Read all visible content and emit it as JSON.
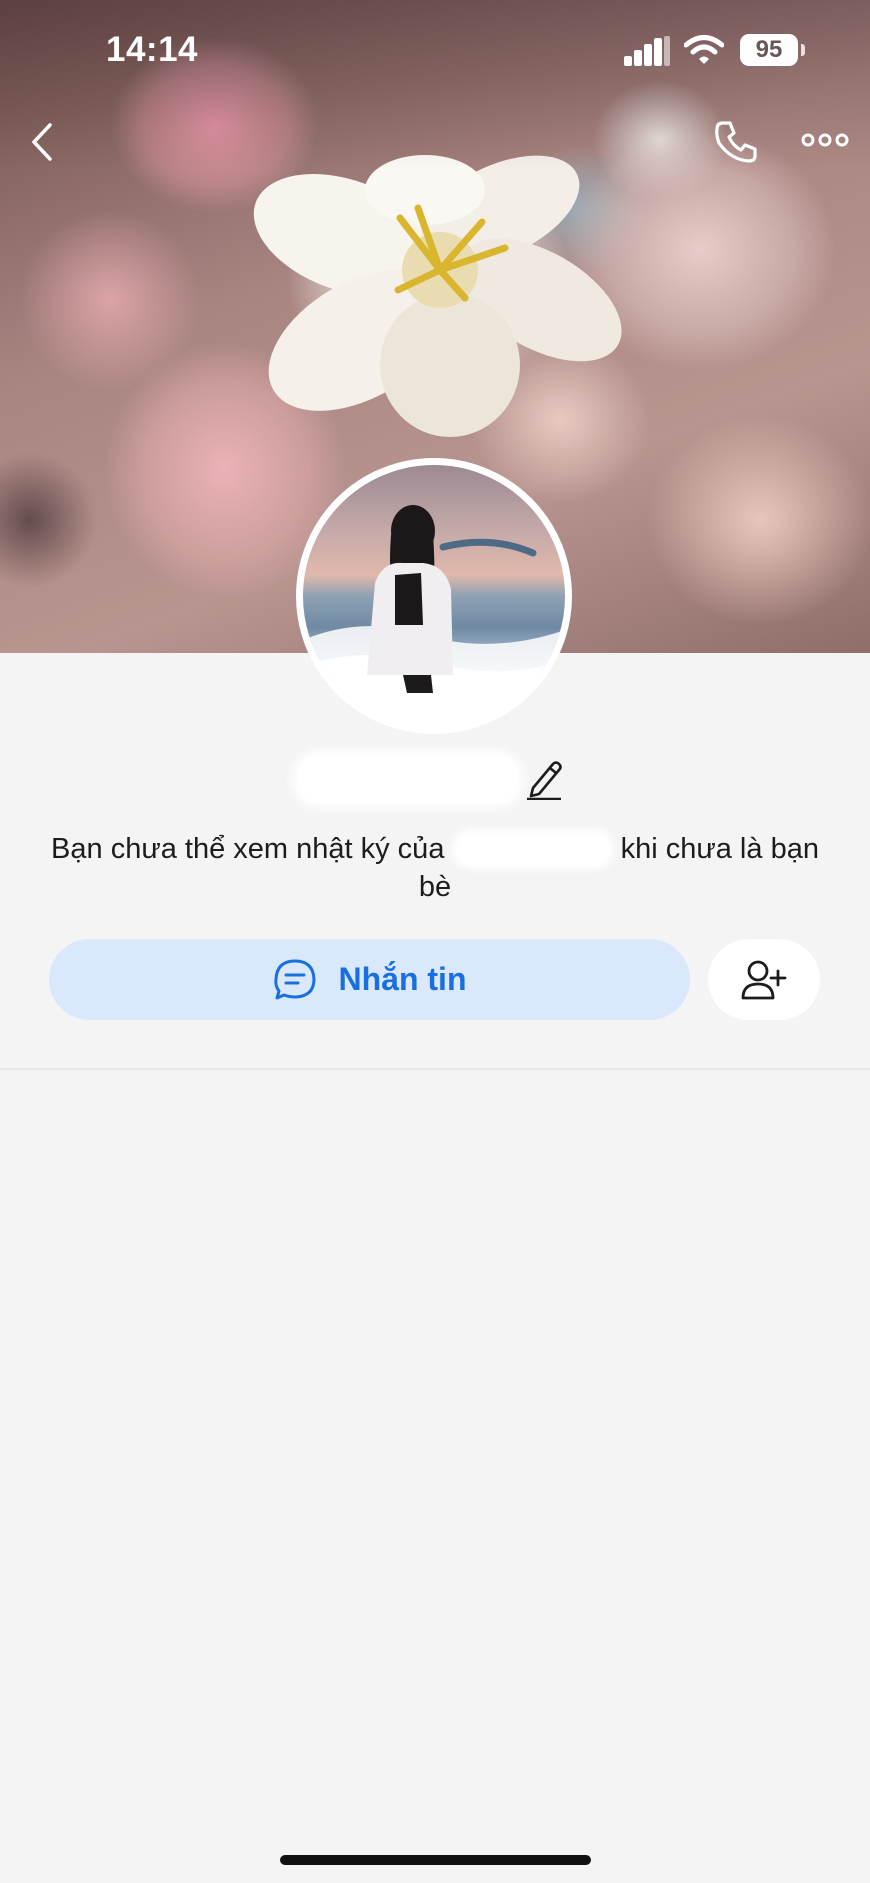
{
  "status_bar": {
    "time": "14:14",
    "battery": "95"
  },
  "profile": {
    "name": "",
    "notice_before": "Bạn chưa thể xem nhật ký của",
    "notice_redacted": "",
    "notice_after": "khi chưa là bạn bè"
  },
  "actions": {
    "message_label": "Nhắn tin"
  },
  "icons": {
    "back": "chevron-left-icon",
    "call": "phone-icon",
    "more": "more-horizontal-icon",
    "edit": "pencil-icon",
    "message": "chat-bubble-icon",
    "add_friend": "user-plus-icon"
  },
  "colors": {
    "accent": "#1a6fe0",
    "message_button_bg": "#d9e8fb",
    "page_bg": "#f4f4f5"
  }
}
